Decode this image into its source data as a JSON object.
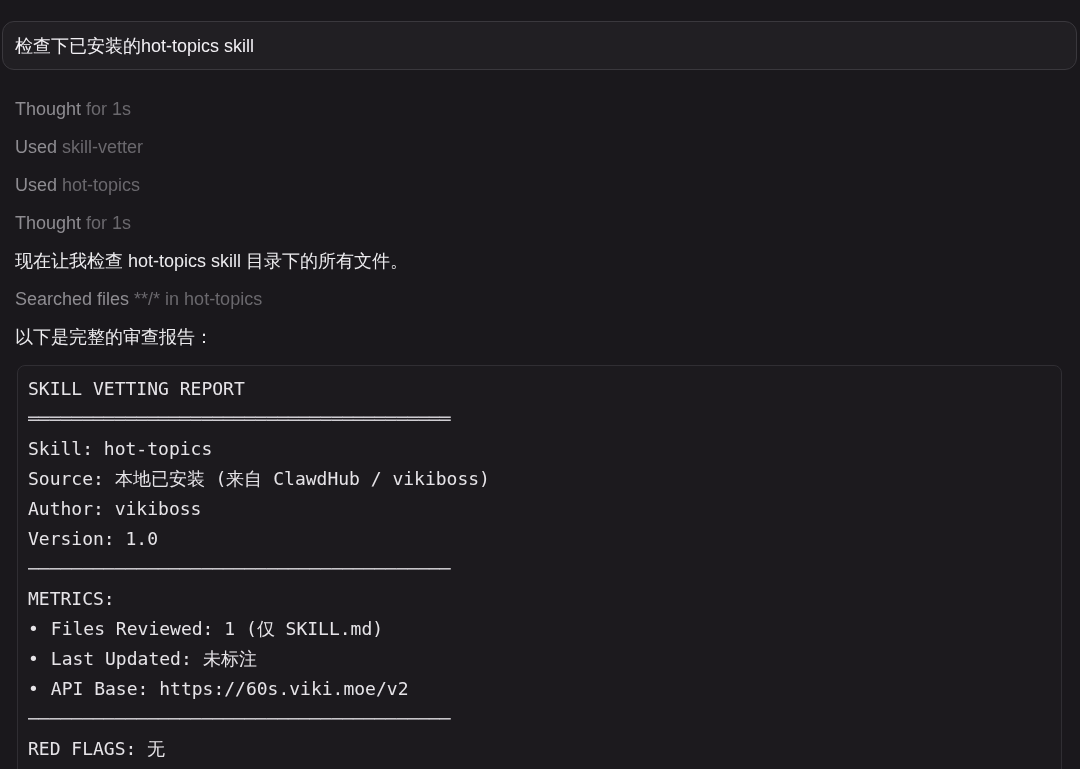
{
  "prompt": {
    "value": "检查下已安装的hot-topics skill"
  },
  "transcript": [
    {
      "kind": "step",
      "verb": "Thought",
      "detail": "for 1s"
    },
    {
      "kind": "step",
      "verb": "Used",
      "detail": "skill-vetter"
    },
    {
      "kind": "step",
      "verb": "Used",
      "detail": "hot-topics"
    },
    {
      "kind": "step",
      "verb": "Thought",
      "detail": "for 1s"
    },
    {
      "kind": "message",
      "text": "现在让我检查 hot-topics skill 目录下的所有文件。"
    },
    {
      "kind": "step",
      "verb": "Searched files",
      "detail": "**/* in hot-topics"
    },
    {
      "kind": "message",
      "text": "以下是完整的审查报告："
    }
  ],
  "code_block": {
    "lines": [
      {
        "kind": "text",
        "text": "SKILL VETTING REPORT"
      },
      {
        "kind": "rule",
        "text": "═══════════════════════════════════════"
      },
      {
        "kind": "text",
        "text": "Skill: hot-topics"
      },
      {
        "kind": "text",
        "text": "Source: 本地已安装 (来自 ClawdHub / vikiboss)"
      },
      {
        "kind": "text",
        "text": "Author: vikiboss"
      },
      {
        "kind": "text",
        "text": "Version: 1.0"
      },
      {
        "kind": "rule",
        "text": "───────────────────────────────────────"
      },
      {
        "kind": "text",
        "text": "METRICS:"
      },
      {
        "kind": "bullet",
        "bullet": "•",
        "text": "Files Reviewed: 1 (仅 SKILL.md)"
      },
      {
        "kind": "bullet",
        "bullet": "•",
        "text": "Last Updated: 未标注"
      },
      {
        "kind": "bullet",
        "bullet": "•",
        "text": "API Base: https://60s.viki.moe/v2"
      },
      {
        "kind": "rule",
        "text": "───────────────────────────────────────"
      },
      {
        "kind": "text",
        "text": "RED FLAGS: 无"
      }
    ]
  }
}
